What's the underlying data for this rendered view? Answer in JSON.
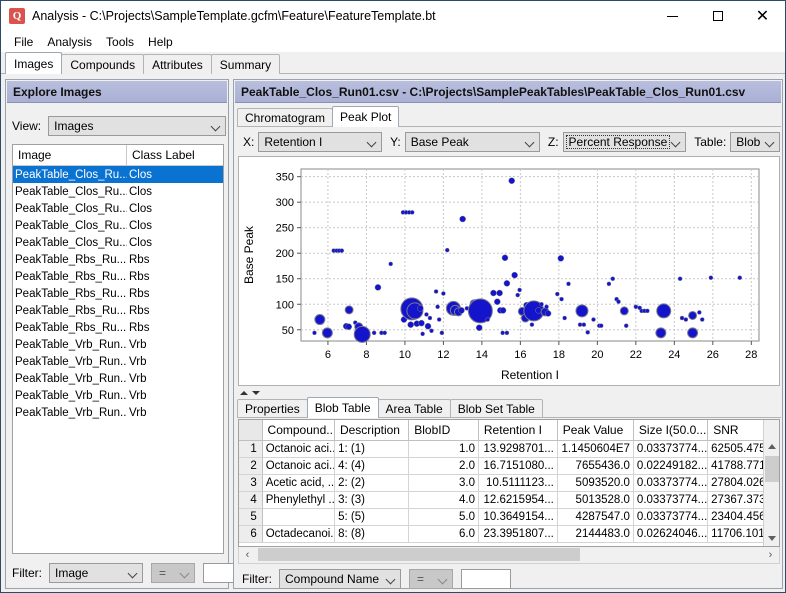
{
  "window": {
    "title": "Analysis - C:\\Projects\\SampleTemplate.gcfm\\Feature\\FeatureTemplate.bt",
    "app_icon_letter": "Q",
    "minimize": "–",
    "maximize": "☐",
    "close": "×"
  },
  "menu": [
    "File",
    "Analysis",
    "Tools",
    "Help"
  ],
  "top_tabs": [
    {
      "label": "Images",
      "selected": true
    },
    {
      "label": "Compounds",
      "selected": false
    },
    {
      "label": "Attributes",
      "selected": false
    },
    {
      "label": "Summary",
      "selected": false
    }
  ],
  "left_panel": {
    "header": "Explore Images",
    "view_label": "View:",
    "view_value": "Images",
    "columns": [
      "Image",
      "Class Label"
    ],
    "rows": [
      {
        "image": "PeakTable_Clos_Ru...",
        "label": "Clos",
        "selected": true
      },
      {
        "image": "PeakTable_Clos_Ru...",
        "label": "Clos",
        "selected": false
      },
      {
        "image": "PeakTable_Clos_Ru...",
        "label": "Clos",
        "selected": false
      },
      {
        "image": "PeakTable_Clos_Ru...",
        "label": "Clos",
        "selected": false
      },
      {
        "image": "PeakTable_Clos_Ru...",
        "label": "Clos",
        "selected": false
      },
      {
        "image": "PeakTable_Rbs_Ru...",
        "label": "Rbs",
        "selected": false
      },
      {
        "image": "PeakTable_Rbs_Ru...",
        "label": "Rbs",
        "selected": false
      },
      {
        "image": "PeakTable_Rbs_Ru...",
        "label": "Rbs",
        "selected": false
      },
      {
        "image": "PeakTable_Rbs_Ru...",
        "label": "Rbs",
        "selected": false
      },
      {
        "image": "PeakTable_Rbs_Ru...",
        "label": "Rbs",
        "selected": false
      },
      {
        "image": "PeakTable_Vrb_Run...",
        "label": "Vrb",
        "selected": false
      },
      {
        "image": "PeakTable_Vrb_Run...",
        "label": "Vrb",
        "selected": false
      },
      {
        "image": "PeakTable_Vrb_Run...",
        "label": "Vrb",
        "selected": false
      },
      {
        "image": "PeakTable_Vrb_Run...",
        "label": "Vrb",
        "selected": false
      },
      {
        "image": "PeakTable_Vrb_Run...",
        "label": "Vrb",
        "selected": false
      }
    ],
    "filter_label": "Filter:",
    "filter_field": "Image",
    "filter_op": "=",
    "filter_value": ""
  },
  "right_panel": {
    "header": "PeakTable_Clos_Run01.csv - C:\\Projects\\SamplePeakTables\\PeakTable_Clos_Run01.csv",
    "plot_tabs": [
      {
        "label": "Chromatogram",
        "selected": false
      },
      {
        "label": "Peak Plot",
        "selected": true
      }
    ],
    "axis_row": {
      "x_label": "X:",
      "x_value": "Retention I",
      "y_label": "Y:",
      "y_value": "Base Peak",
      "z_label": "Z:",
      "z_value": "Percent Response",
      "table_label": "Table:",
      "table_value": "Blob"
    },
    "bottom_tabs": [
      {
        "label": "Properties",
        "selected": false
      },
      {
        "label": "Blob Table",
        "selected": true
      },
      {
        "label": "Area Table",
        "selected": false
      },
      {
        "label": "Blob Set Table",
        "selected": false
      }
    ],
    "table": {
      "columns": [
        "",
        "Compound...",
        "Description",
        "BlobID",
        "Retention I",
        "Peak Value",
        "Size I(50.0...",
        "SNR"
      ],
      "rows": [
        {
          "n": "1",
          "compound": "Octanoic aci...",
          "description": "1: (1)",
          "blobid": "1.0",
          "retention": "13.9298701...",
          "peak": "1.1450604E7",
          "size": "0.03373774...",
          "snr": "62505.475"
        },
        {
          "n": "2",
          "compound": "Octanoic aci...",
          "description": "4: (4)",
          "blobid": "2.0",
          "retention": "16.7151080...",
          "peak": "7655436.0",
          "size": "0.02249182...",
          "snr": "41788.771"
        },
        {
          "n": "3",
          "compound": "Acetic acid, ...",
          "description": "2: (2)",
          "blobid": "3.0",
          "retention": "10.5111123...",
          "peak": "5093520.0",
          "size": "0.03373774...",
          "snr": "27804.026"
        },
        {
          "n": "4",
          "compound": "Phenylethyl ...",
          "description": "3: (3)",
          "blobid": "4.0",
          "retention": "12.6215954...",
          "peak": "5013528.0",
          "size": "0.03373774...",
          "snr": "27367.373"
        },
        {
          "n": "5",
          "compound": "",
          "description": "5: (5)",
          "blobid": "5.0",
          "retention": "10.3649154...",
          "peak": "4287547.0",
          "size": "0.03373774...",
          "snr": "23404.456"
        },
        {
          "n": "6",
          "compound": "Octadecanoi...",
          "description": "8: (8)",
          "blobid": "6.0",
          "retention": "23.3951807...",
          "peak": "2144483.0",
          "size": "0.02624046...",
          "snr": "11706.101"
        }
      ]
    },
    "filter_label": "Filter:",
    "filter_field": "Compound Name",
    "filter_op": "=",
    "filter_value": "",
    "scroll_left": "‹",
    "scroll_right": "›"
  },
  "colors": {
    "marker": "#1414cc",
    "marker_stroke": "#7a7a8c",
    "header_gradient_top": "#b9bede",
    "header_gradient_bottom": "#a9b0d4",
    "selection": "#0a72d0",
    "window_border": "#2b4b66",
    "app_icon": "#d9534f"
  },
  "chart_data": {
    "type": "scatter",
    "title": "",
    "xlabel": "Retention I",
    "ylabel": "Base Peak",
    "xlim": [
      4.6,
      28.4
    ],
    "ylim": [
      28,
      365
    ],
    "xticks": [
      6,
      8,
      10,
      12,
      14,
      16,
      18,
      20,
      22,
      24,
      26,
      28
    ],
    "yticks": [
      50,
      100,
      150,
      200,
      250,
      300,
      350
    ],
    "grid": true,
    "legend": false,
    "size_encodes": "Percent Response",
    "points": [
      {
        "x": 5.3,
        "y": 44,
        "s": 2
      },
      {
        "x": 5.58,
        "y": 70,
        "s": 5
      },
      {
        "x": 5.97,
        "y": 44,
        "s": 5
      },
      {
        "x": 6.3,
        "y": 205,
        "s": 2
      },
      {
        "x": 6.45,
        "y": 205,
        "s": 2
      },
      {
        "x": 6.58,
        "y": 205,
        "s": 2
      },
      {
        "x": 6.72,
        "y": 205,
        "s": 2
      },
      {
        "x": 6.95,
        "y": 57,
        "s": 3
      },
      {
        "x": 7.08,
        "y": 56,
        "s": 3
      },
      {
        "x": 7.1,
        "y": 89,
        "s": 4
      },
      {
        "x": 7.42,
        "y": 64,
        "s": 2
      },
      {
        "x": 7.6,
        "y": 56,
        "s": 4
      },
      {
        "x": 7.78,
        "y": 41,
        "s": 8
      },
      {
        "x": 8.4,
        "y": 44,
        "s": 2
      },
      {
        "x": 8.6,
        "y": 133,
        "s": 3
      },
      {
        "x": 8.78,
        "y": 44,
        "s": 2
      },
      {
        "x": 8.95,
        "y": 44,
        "s": 2
      },
      {
        "x": 9.26,
        "y": 179,
        "s": 2
      },
      {
        "x": 9.9,
        "y": 280,
        "s": 2
      },
      {
        "x": 10.06,
        "y": 280,
        "s": 2
      },
      {
        "x": 10.22,
        "y": 280,
        "s": 2
      },
      {
        "x": 10.38,
        "y": 280,
        "s": 2
      },
      {
        "x": 9.95,
        "y": 70,
        "s": 3
      },
      {
        "x": 10.3,
        "y": 60,
        "s": 3
      },
      {
        "x": 10.36,
        "y": 91,
        "s": 11
      },
      {
        "x": 10.52,
        "y": 87,
        "s": 8
      },
      {
        "x": 10.62,
        "y": 62,
        "s": 3
      },
      {
        "x": 10.8,
        "y": 92,
        "s": 3
      },
      {
        "x": 10.86,
        "y": 63,
        "s": 3
      },
      {
        "x": 10.92,
        "y": 42,
        "s": 2
      },
      {
        "x": 11.12,
        "y": 80,
        "s": 2
      },
      {
        "x": 11.2,
        "y": 57,
        "s": 3
      },
      {
        "x": 11.3,
        "y": 73,
        "s": 2
      },
      {
        "x": 11.38,
        "y": 48,
        "s": 2
      },
      {
        "x": 11.62,
        "y": 125,
        "s": 2
      },
      {
        "x": 11.7,
        "y": 95,
        "s": 2
      },
      {
        "x": 11.78,
        "y": 70,
        "s": 2
      },
      {
        "x": 11.92,
        "y": 44,
        "s": 2
      },
      {
        "x": 12.0,
        "y": 121,
        "s": 2
      },
      {
        "x": 12.2,
        "y": 206,
        "s": 2
      },
      {
        "x": 12.52,
        "y": 92,
        "s": 7
      },
      {
        "x": 12.62,
        "y": 88,
        "s": 5
      },
      {
        "x": 12.78,
        "y": 85,
        "s": 4
      },
      {
        "x": 12.94,
        "y": 88,
        "s": 3
      },
      {
        "x": 13.0,
        "y": 267,
        "s": 3
      },
      {
        "x": 13.22,
        "y": 92,
        "s": 2
      },
      {
        "x": 13.4,
        "y": 89,
        "s": 2
      },
      {
        "x": 13.6,
        "y": 101,
        "s": 4
      },
      {
        "x": 13.66,
        "y": 103,
        "s": 3
      },
      {
        "x": 13.92,
        "y": 87,
        "s": 12
      },
      {
        "x": 13.86,
        "y": 54,
        "s": 3
      },
      {
        "x": 14.3,
        "y": 70,
        "s": 2
      },
      {
        "x": 14.6,
        "y": 122,
        "s": 3
      },
      {
        "x": 14.8,
        "y": 105,
        "s": 3
      },
      {
        "x": 14.92,
        "y": 122,
        "s": 3
      },
      {
        "x": 14.96,
        "y": 88,
        "s": 3
      },
      {
        "x": 15.1,
        "y": 88,
        "s": 3
      },
      {
        "x": 15.2,
        "y": 191,
        "s": 3
      },
      {
        "x": 15.3,
        "y": 141,
        "s": 3
      },
      {
        "x": 15.08,
        "y": 44,
        "s": 2
      },
      {
        "x": 15.3,
        "y": 44,
        "s": 2
      },
      {
        "x": 15.55,
        "y": 342,
        "s": 3
      },
      {
        "x": 15.7,
        "y": 157,
        "s": 3
      },
      {
        "x": 15.86,
        "y": 118,
        "s": 2
      },
      {
        "x": 15.96,
        "y": 128,
        "s": 2
      },
      {
        "x": 16.1,
        "y": 86,
        "s": 4
      },
      {
        "x": 16.26,
        "y": 73,
        "s": 4
      },
      {
        "x": 16.32,
        "y": 98,
        "s": 3
      },
      {
        "x": 16.4,
        "y": 82,
        "s": 2
      },
      {
        "x": 16.5,
        "y": 90,
        "s": 3
      },
      {
        "x": 16.7,
        "y": 87,
        "s": 10
      },
      {
        "x": 16.6,
        "y": 60,
        "s": 2
      },
      {
        "x": 16.94,
        "y": 88,
        "s": 3
      },
      {
        "x": 17.1,
        "y": 100,
        "s": 2
      },
      {
        "x": 17.28,
        "y": 85,
        "s": 4
      },
      {
        "x": 17.36,
        "y": 95,
        "s": 2
      },
      {
        "x": 17.44,
        "y": 82,
        "s": 3
      },
      {
        "x": 18.1,
        "y": 190,
        "s": 3
      },
      {
        "x": 17.92,
        "y": 120,
        "s": 2
      },
      {
        "x": 18.14,
        "y": 110,
        "s": 2
      },
      {
        "x": 18.3,
        "y": 73,
        "s": 2
      },
      {
        "x": 18.5,
        "y": 140,
        "s": 2
      },
      {
        "x": 19.2,
        "y": 87,
        "s": 6
      },
      {
        "x": 19.1,
        "y": 60,
        "s": 2
      },
      {
        "x": 19.3,
        "y": 60,
        "s": 2
      },
      {
        "x": 19.5,
        "y": 45,
        "s": 2
      },
      {
        "x": 19.8,
        "y": 70,
        "s": 2
      },
      {
        "x": 20.1,
        "y": 58,
        "s": 2
      },
      {
        "x": 20.2,
        "y": 58,
        "s": 2
      },
      {
        "x": 20.6,
        "y": 140,
        "s": 2
      },
      {
        "x": 20.8,
        "y": 150,
        "s": 2
      },
      {
        "x": 21.0,
        "y": 110,
        "s": 2
      },
      {
        "x": 21.1,
        "y": 105,
        "s": 2
      },
      {
        "x": 21.4,
        "y": 87,
        "s": 4
      },
      {
        "x": 21.5,
        "y": 58,
        "s": 2
      },
      {
        "x": 22.0,
        "y": 95,
        "s": 2
      },
      {
        "x": 22.2,
        "y": 93,
        "s": 2
      },
      {
        "x": 22.3,
        "y": 87,
        "s": 2
      },
      {
        "x": 22.45,
        "y": 87,
        "s": 2
      },
      {
        "x": 22.6,
        "y": 87,
        "s": 2
      },
      {
        "x": 23.3,
        "y": 44,
        "s": 5
      },
      {
        "x": 23.45,
        "y": 87,
        "s": 7
      },
      {
        "x": 24.3,
        "y": 150,
        "s": 2
      },
      {
        "x": 24.4,
        "y": 73,
        "s": 2
      },
      {
        "x": 24.6,
        "y": 70,
        "s": 2
      },
      {
        "x": 24.95,
        "y": 78,
        "s": 4
      },
      {
        "x": 24.95,
        "y": 44,
        "s": 5
      },
      {
        "x": 25.3,
        "y": 84,
        "s": 2
      },
      {
        "x": 25.45,
        "y": 70,
        "s": 2
      },
      {
        "x": 25.9,
        "y": 152,
        "s": 2
      },
      {
        "x": 27.4,
        "y": 152,
        "s": 2
      }
    ]
  }
}
